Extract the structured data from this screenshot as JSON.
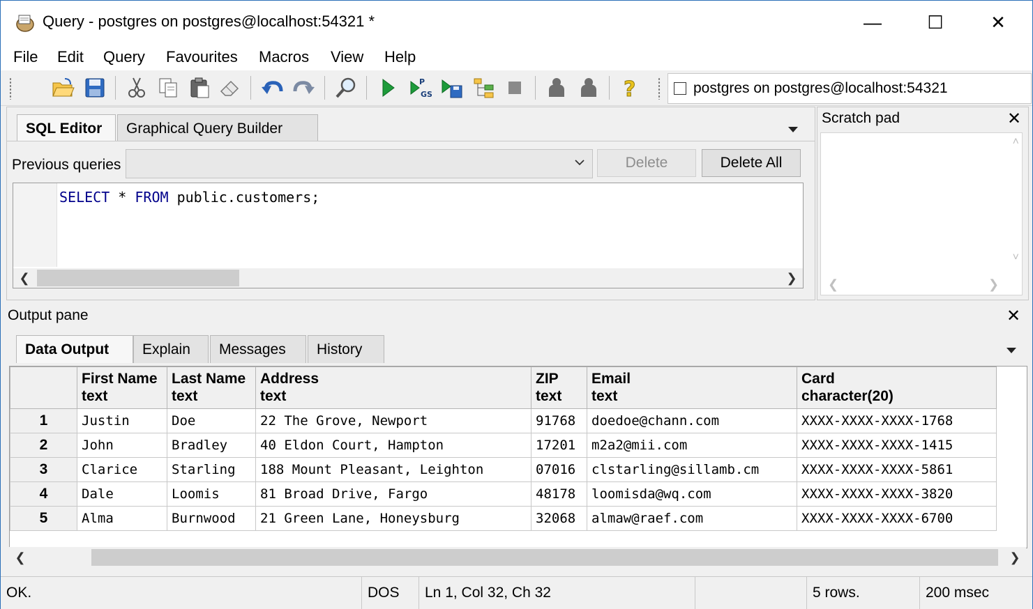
{
  "window": {
    "title": "Query - postgres on postgres@localhost:54321 *",
    "icon": "pgadmin-query-icon",
    "controls": {
      "minimize": "—",
      "maximize": "☐",
      "close": "✕"
    }
  },
  "menu": [
    "File",
    "Edit",
    "Query",
    "Favourites",
    "Macros",
    "View",
    "Help"
  ],
  "toolbar": {
    "icons": [
      "open-file-icon",
      "save-icon",
      "cut-icon",
      "copy-icon",
      "paste-icon",
      "clear-icon",
      "undo-icon",
      "redo-icon",
      "find-icon",
      "execute-icon",
      "execute-pgscript-icon",
      "execute-to-file-icon",
      "explain-icon",
      "cancel-icon",
      "help-icon"
    ],
    "connection": "postgres on postgres@localhost:54321"
  },
  "sql_panel": {
    "tabs": [
      "SQL Editor",
      "Graphical Query Builder"
    ],
    "previous_queries_label": "Previous queries",
    "previous_queries_value": "",
    "delete_label": "Delete",
    "delete_all_label": "Delete All",
    "query": {
      "kw1": "SELECT",
      "mid": " * ",
      "kw2": "FROM",
      "rest": " public.customers;"
    }
  },
  "scratch_pad": {
    "title": "Scratch pad",
    "content": ""
  },
  "output": {
    "title": "Output pane",
    "tabs": [
      "Data Output",
      "Explain",
      "Messages",
      "History"
    ],
    "columns": [
      {
        "name": "First Name",
        "type": "text"
      },
      {
        "name": "Last Name",
        "type": "text"
      },
      {
        "name": "Address",
        "type": "text"
      },
      {
        "name": "ZIP",
        "type": "text"
      },
      {
        "name": "Email",
        "type": "text"
      },
      {
        "name": "Card",
        "type": "character(20)"
      }
    ],
    "rows": [
      [
        "1",
        "Justin",
        "Doe",
        "22 The Grove, Newport",
        "91768",
        "doedoe@chann.com",
        "XXXX-XXXX-XXXX-1768"
      ],
      [
        "2",
        "John",
        "Bradley",
        "40 Eldon Court, Hampton",
        "17201",
        "m2a2@mii.com",
        "XXXX-XXXX-XXXX-1415"
      ],
      [
        "3",
        "Clarice",
        "Starling",
        "188 Mount Pleasant, Leighton",
        "07016",
        "clstarling@sillamb.cm",
        "XXXX-XXXX-XXXX-5861"
      ],
      [
        "4",
        "Dale",
        "Loomis",
        "81 Broad Drive, Fargo",
        "48178",
        "loomisda@wq.com",
        "XXXX-XXXX-XXXX-3820"
      ],
      [
        "5",
        "Alma",
        "Burnwood",
        "21 Green Lane, Honeysburg",
        "32068",
        "almaw@raef.com",
        "XXXX-XXXX-XXXX-6700"
      ]
    ]
  },
  "status": {
    "state": "OK.",
    "line_endings": "DOS",
    "position": "Ln 1, Col 32, Ch 32",
    "rows": "5 rows.",
    "time": "200 msec"
  }
}
